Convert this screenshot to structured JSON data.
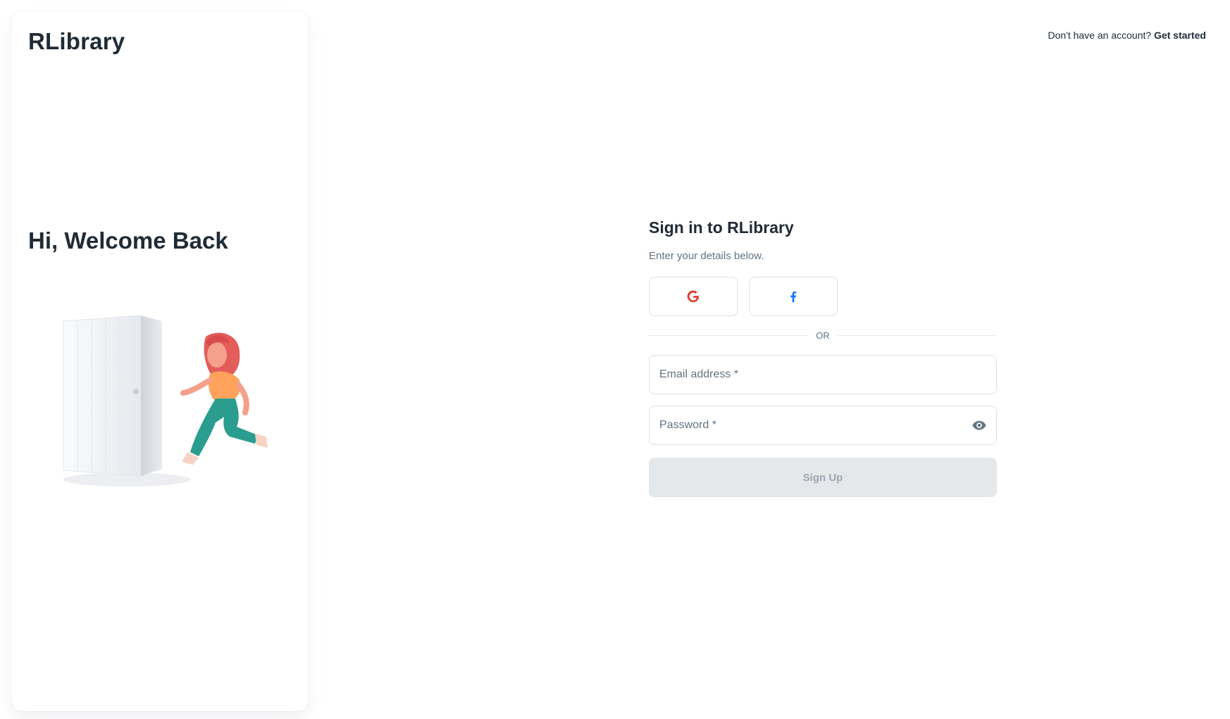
{
  "brand": {
    "name": "RLibrary"
  },
  "side_panel": {
    "welcome": "Hi, Welcome Back"
  },
  "top_bar": {
    "prompt": "Don't have an account?",
    "cta": "Get started"
  },
  "form": {
    "title": "Sign in to RLibrary",
    "subtitle": "Enter your details below.",
    "social": [
      {
        "provider": "google",
        "icon": "google-icon",
        "color": "#df3e30"
      },
      {
        "provider": "facebook",
        "icon": "facebook-icon",
        "color": "#1877f2"
      }
    ],
    "divider": "OR",
    "email_label": "Email address *",
    "password_label": "Password *",
    "submit_label": "Sign Up"
  }
}
